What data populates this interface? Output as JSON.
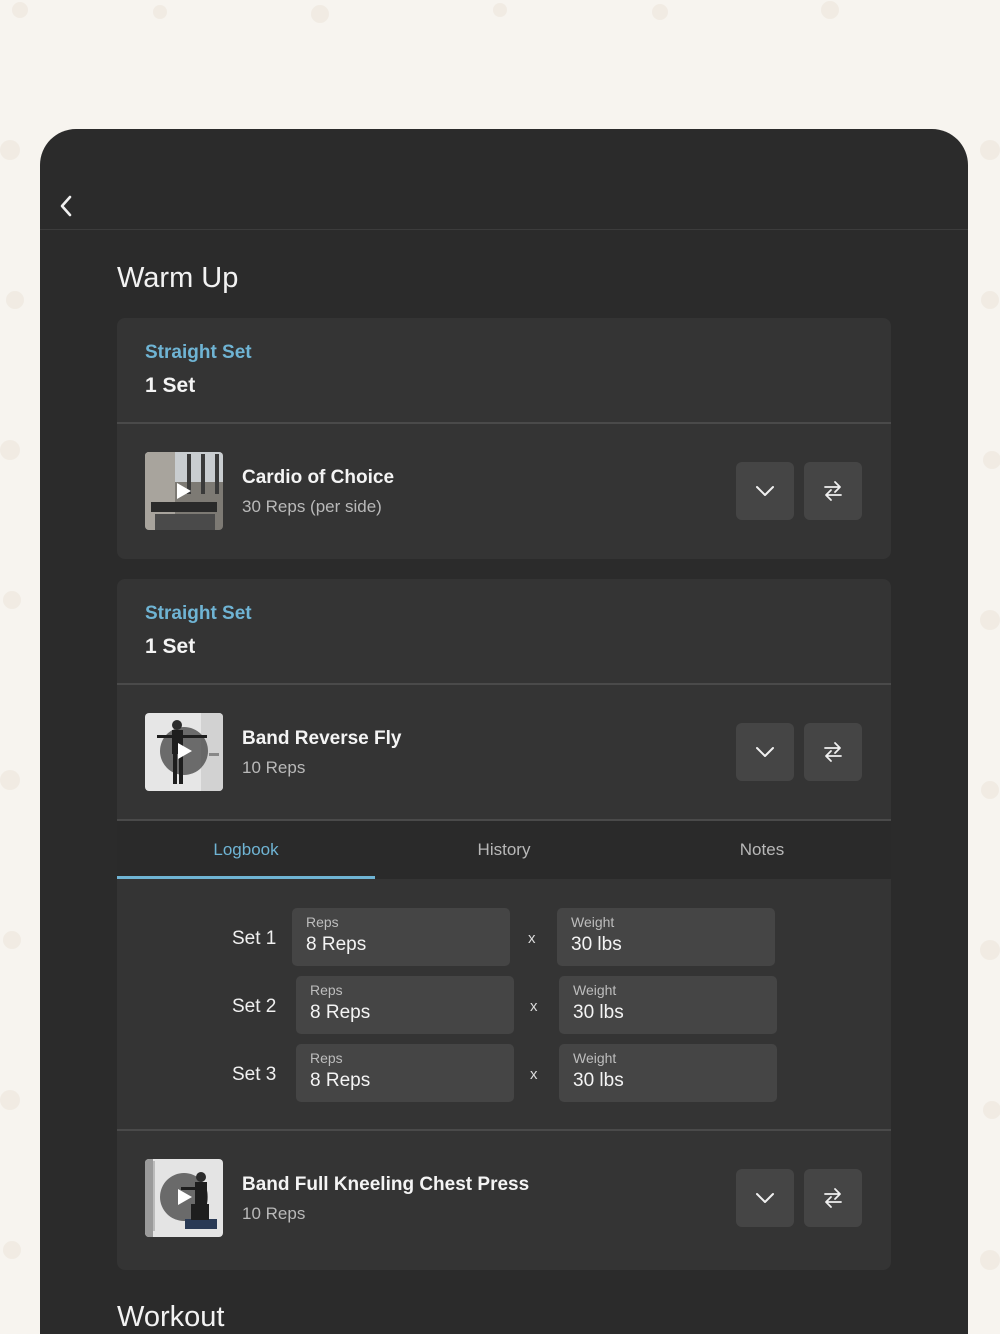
{
  "nav": {
    "back_icon": "chevron-left-icon"
  },
  "sections": {
    "warmup_title": "Warm Up",
    "workout_title": "Workout"
  },
  "groups": [
    {
      "set_type": "Straight Set",
      "set_count": "1 Set",
      "exercise": {
        "name": "Cardio of Choice",
        "detail": "30 Reps (per side)"
      }
    },
    {
      "set_type": "Straight Set",
      "set_count": "1 Set",
      "exercise": {
        "name": "Band Reverse Fly",
        "detail": "10 Reps"
      },
      "tabs": [
        "Logbook",
        "History",
        "Notes"
      ],
      "active_tab": "Logbook",
      "sets": [
        {
          "label": "Set 1",
          "reps_label": "Reps",
          "reps_value": "8 Reps",
          "times": "x",
          "weight_label": "Weight",
          "weight_value": "30 lbs"
        },
        {
          "label": "Set 2",
          "reps_label": "Reps",
          "reps_value": "8 Reps",
          "times": "x",
          "weight_label": "Weight",
          "weight_value": "30 lbs"
        },
        {
          "label": "Set 3",
          "reps_label": "Reps",
          "reps_value": "8 Reps",
          "times": "x",
          "weight_label": "Weight",
          "weight_value": "30 lbs"
        }
      ],
      "exercise2": {
        "name": "Band Full Kneeling Chest Press",
        "detail": "10 Reps"
      }
    }
  ],
  "colors": {
    "accent": "#6fb4d4",
    "panel": "#343434",
    "background": "#2b2b2b",
    "button": "#454545"
  }
}
